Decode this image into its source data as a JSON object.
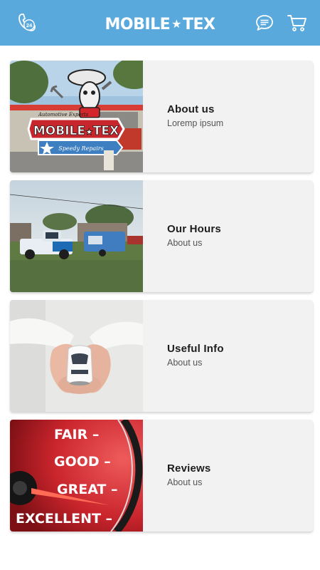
{
  "header": {
    "logo_left": "MOBILE",
    "logo_star": "★",
    "logo_right": "TEX",
    "call_badge": "24",
    "icons": [
      "phone-24-icon",
      "chat-icon",
      "cart-icon"
    ],
    "color": "#5aa9dd"
  },
  "cards": [
    {
      "title": "About us",
      "subtitle": "Loremp ipsum",
      "image": "mobile-tex-logo-photo",
      "logo_left": "MOBILE",
      "logo_star": "★",
      "logo_right": "TEX",
      "logo_tagline_top": "Automotive Experts",
      "logo_tagline_bottom": "Speedy Repairs"
    },
    {
      "title": "Our Hours",
      "subtitle": "About us",
      "image": "service-truck-photo"
    },
    {
      "title": "Useful Info",
      "subtitle": "About us",
      "image": "hands-holding-car-photo"
    },
    {
      "title": "Reviews",
      "subtitle": "About us",
      "image": "rating-gauge-photo",
      "gauge_labels": [
        "FAIR –",
        "GOOD –",
        "GREAT –",
        "EXCELLENT –"
      ]
    }
  ]
}
